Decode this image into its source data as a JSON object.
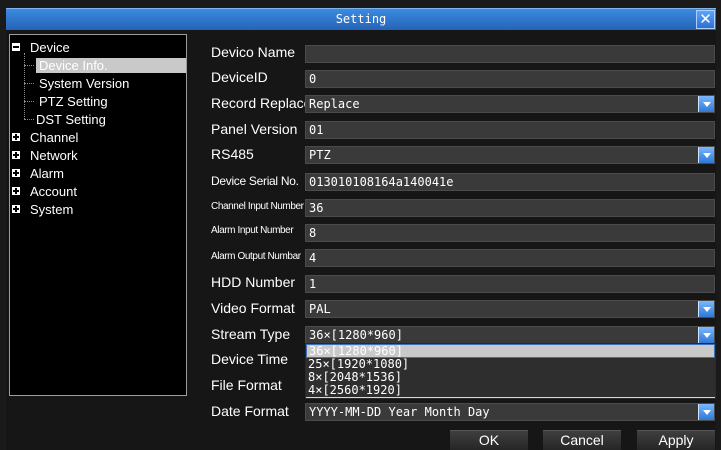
{
  "window": {
    "title": "Setting"
  },
  "tree": {
    "device": "Device",
    "device_info": "Device Info.",
    "system_version": "System Version",
    "ptz_setting": "PTZ Setting",
    "dst_setting": "DST Setting",
    "channel": "Channel",
    "network": "Network",
    "alarm": "Alarm",
    "account": "Account",
    "system": "System"
  },
  "form": {
    "device_name": {
      "label": "Devico Name",
      "value": ""
    },
    "device_id": {
      "label": "DeviceID",
      "value": "0"
    },
    "record_replace": {
      "label": "Record Replace",
      "value": "Replace"
    },
    "panel_version": {
      "label": "Panel Version",
      "value": "01"
    },
    "rs485": {
      "label": "RS485",
      "value": "PTZ"
    },
    "serial_no": {
      "label": "Device Serial No.",
      "value": "013010108164a140041e"
    },
    "channel_input": {
      "label": "Channel Input Number",
      "value": "36"
    },
    "alarm_input": {
      "label": "Alarm Input Number",
      "value": "8"
    },
    "alarm_output": {
      "label": "Alarm Output Numbar",
      "value": "4"
    },
    "hdd_number": {
      "label": "HDD Number",
      "value": "1"
    },
    "video_format": {
      "label": "Video Format",
      "value": "PAL"
    },
    "stream_type": {
      "label": "Stream Type",
      "value": "36×[1280*960]"
    },
    "device_time": {
      "label": "Device Time"
    },
    "file_format": {
      "label": "File Format"
    },
    "date_format": {
      "label": "Date Format",
      "value": "YYYY-MM-DD Year Month Day"
    }
  },
  "stream_options": [
    "36×[1280*960]",
    "25×[1920*1080]",
    "8×[2048*1536]",
    "4×[2560*1920]"
  ],
  "buttons": {
    "ok": "OK",
    "cancel": "Cancel",
    "apply": "Apply"
  }
}
